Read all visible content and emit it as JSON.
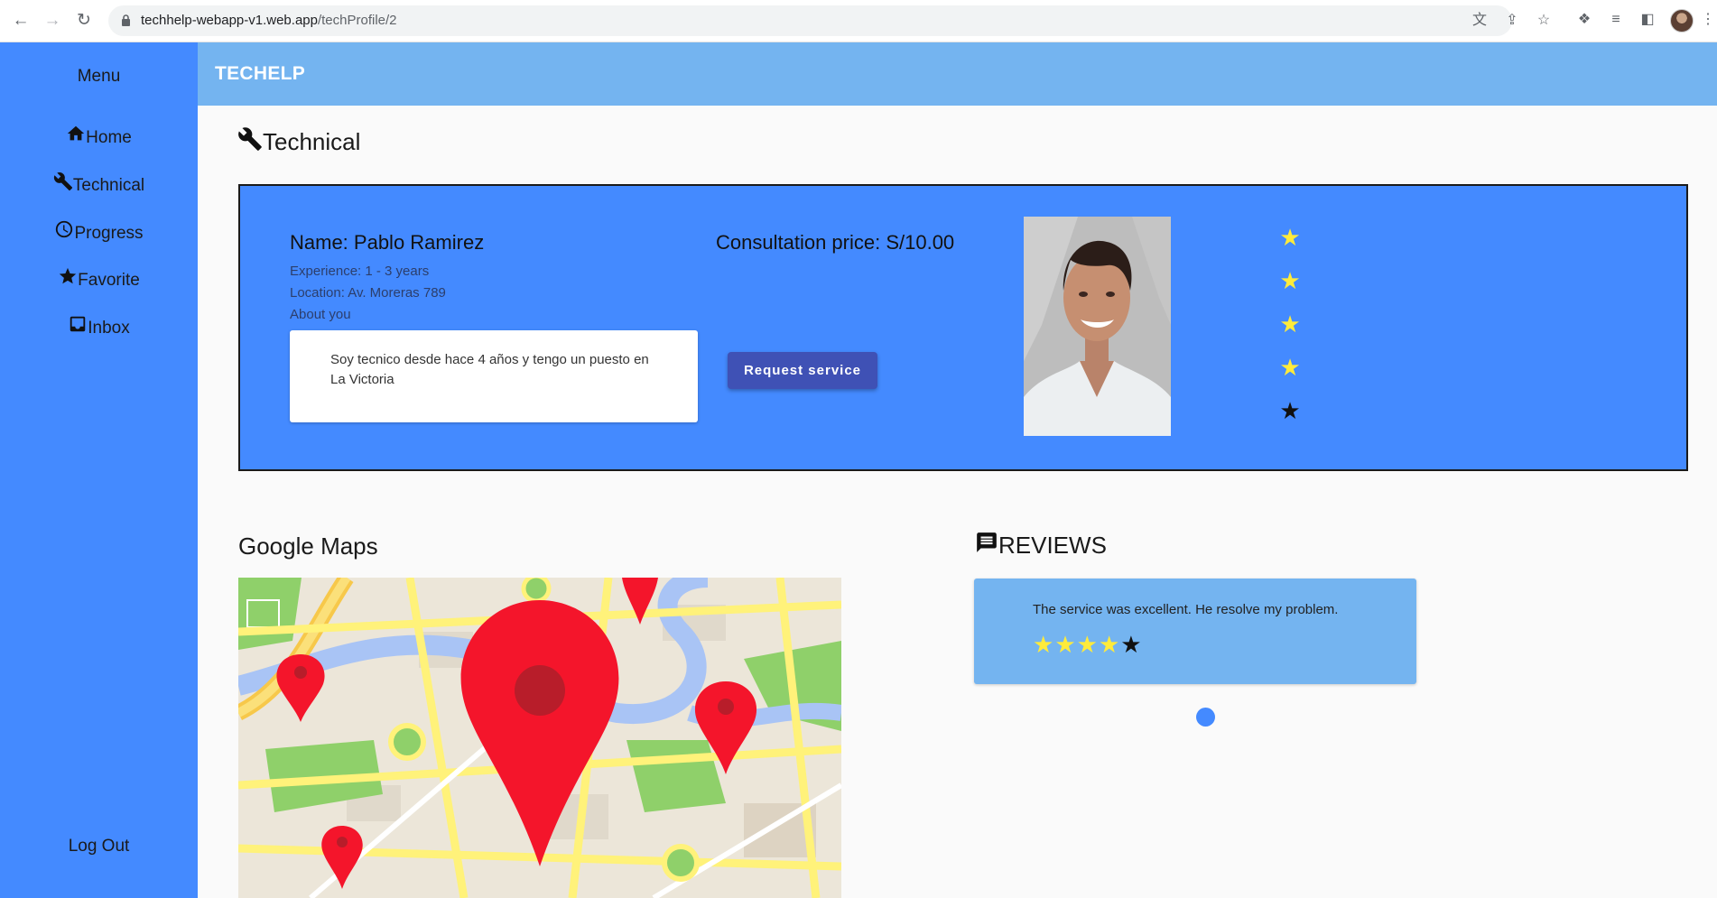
{
  "browser": {
    "url_host": "techhelp-webapp-v1.web.app",
    "url_path": "/techProfile/2",
    "back_icon": "arrow-left-icon",
    "forward_icon": "arrow-right-icon",
    "reload_icon": "reload-icon"
  },
  "sidebar": {
    "title": "Menu",
    "items": [
      {
        "label": "Home",
        "icon": "home-icon"
      },
      {
        "label": "Technical",
        "icon": "wrench-icon"
      },
      {
        "label": "Progress",
        "icon": "clock-icon"
      },
      {
        "label": "Favorite",
        "icon": "star-icon"
      },
      {
        "label": "Inbox",
        "icon": "inbox-icon"
      }
    ],
    "logout": "Log Out"
  },
  "topbar": {
    "brand": "TECHELP"
  },
  "page": {
    "heading": "Technical",
    "heading_icon": "wrench-icon"
  },
  "profile": {
    "name": "Name: Pablo Ramirez",
    "experience": "Experience: 1 - 3 years",
    "location": "Location: Av. Moreras 789",
    "about_label": "About you",
    "about_text": "Soy tecnico desde hace 4 años y tengo un puesto en La Victoria",
    "price": "Consultation price: S/10.00",
    "request_button": "Request service",
    "rating": 4,
    "rating_max": 5,
    "colors": {
      "card": "#448aff",
      "button": "#3f51b5",
      "star_filled": "#ffeb3b",
      "star_empty": "#111111"
    }
  },
  "maps": {
    "title": "Google Maps"
  },
  "reviews": {
    "title": "REVIEWS",
    "title_icon": "comment-icon",
    "items": [
      {
        "text": "The service was excellent. He resolve my problem.",
        "rating": 4,
        "rating_max": 5
      }
    ]
  }
}
